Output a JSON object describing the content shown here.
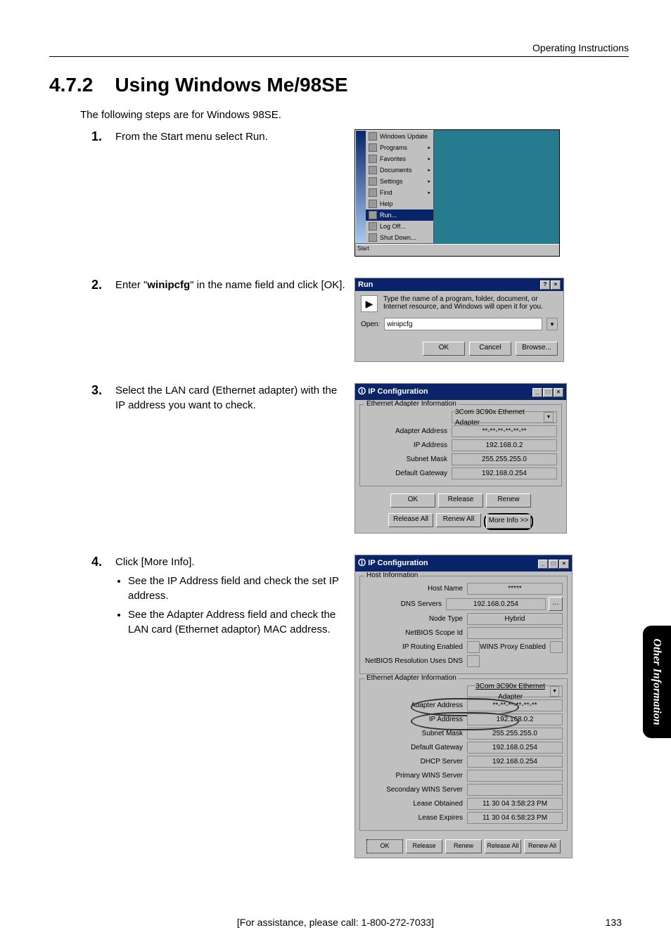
{
  "header": {
    "running": "Operating Instructions"
  },
  "section": {
    "number": "4.7.2",
    "title": "Using Windows Me/98SE",
    "intro": "The following steps are for Windows 98SE."
  },
  "steps": {
    "s1": {
      "num": "1.",
      "text": "From the Start menu select Run."
    },
    "s2": {
      "num": "2.",
      "text_a": "Enter \"",
      "bold": "winipcfg",
      "text_b": "\" in the name field and click [OK]."
    },
    "s3": {
      "num": "3.",
      "text": "Select the LAN card (Ethernet adapter) with the IP address you want to check."
    },
    "s4": {
      "num": "4.",
      "text": "Click [More Info].",
      "b1": "See the IP Address field and check the set IP address.",
      "b2": "See the Adapter Address field and check the LAN card (Ethernet adaptor) MAC address."
    }
  },
  "fig1": {
    "items": [
      "Windows Update",
      "Programs",
      "Favorites",
      "Documents",
      "Settings",
      "Find",
      "Help",
      "Run...",
      "Log Off...",
      "Shut Down..."
    ],
    "taskbar": "Start"
  },
  "fig2": {
    "title": "Run",
    "msg": "Type the name of a program, folder, document, or Internet resource, and Windows will open it for you.",
    "open_label": "Open:",
    "open_value": "winipcfg",
    "ok": "OK",
    "cancel": "Cancel",
    "browse": "Browse..."
  },
  "fig3": {
    "title": "IP Configuration",
    "group": "Ethernet Adapter Information",
    "adapter_sel": "3Com 3C90x Ethernet Adapter",
    "rows": {
      "adapter_addr_k": "Adapter Address",
      "adapter_addr_v": "**-**-**-**-**-**",
      "ip_k": "IP Address",
      "ip_v": "192.168.0.2",
      "mask_k": "Subnet Mask",
      "mask_v": "255.255.255.0",
      "gw_k": "Default Gateway",
      "gw_v": "192.168.0.254"
    },
    "btns": {
      "ok": "OK",
      "release": "Release",
      "renew": "Renew",
      "release_all": "Release All",
      "renew_all": "Renew All",
      "more": "More Info >>"
    }
  },
  "fig4": {
    "title": "IP Configuration",
    "host_group": "Host Information",
    "host": {
      "hostname_k": "Host Name",
      "hostname_v": "*****",
      "dns_k": "DNS Servers",
      "dns_v": "192.168.0.254",
      "node_k": "Node Type",
      "node_v": "Hybrid",
      "scope_k": "NetBIOS Scope Id",
      "scope_v": "",
      "iprt_k": "IP Routing Enabled",
      "iprt_v": "",
      "wins_k": "WINS Proxy Enabled",
      "wins_v": "",
      "nbdns_k": "NetBIOS Resolution Uses DNS",
      "nbdns_v": ""
    },
    "adapter_group": "Ethernet Adapter Information",
    "adapter_sel": "3Com 3C90x Ethernet Adapter",
    "adapter": {
      "addr_k": "Adapter Address",
      "addr_v": "**-**-**-**-**-**",
      "ip_k": "IP Address",
      "ip_v": "192.168.0.2",
      "mask_k": "Subnet Mask",
      "mask_v": "255.255.255.0",
      "gw_k": "Default Gateway",
      "gw_v": "192.168.0.254",
      "dhcp_k": "DHCP Server",
      "dhcp_v": "192.168.0.254",
      "pwins_k": "Primary WINS Server",
      "pwins_v": "",
      "swins_k": "Secondary WINS Server",
      "swins_v": "",
      "lob_k": "Lease Obtained",
      "lob_v": "11 30 04 3:58:23 PM",
      "lex_k": "Lease Expires",
      "lex_v": "11 30 04 6:58:23 PM"
    },
    "btns": {
      "ok": "OK",
      "release": "Release",
      "renew": "Renew",
      "release_all": "Release All",
      "renew_all": "Renew All"
    }
  },
  "side_tab": "Other Information",
  "footer": {
    "assist": "[For assistance, please call: 1-800-272-7033]",
    "page": "133"
  }
}
